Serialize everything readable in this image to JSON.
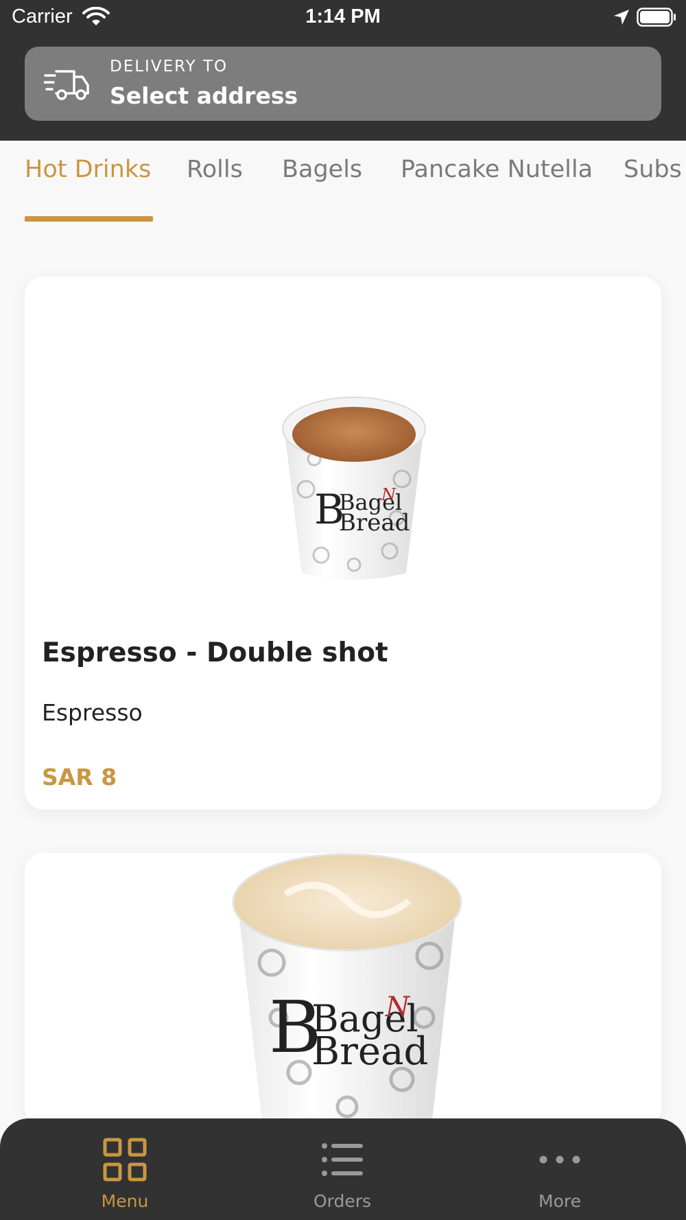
{
  "status_bar": {
    "carrier": "Carrier",
    "time": "1:14 PM"
  },
  "delivery": {
    "kicker": "DELIVERY TO",
    "address": "Select address"
  },
  "tabs": [
    {
      "label": "Hot Drinks",
      "active": true
    },
    {
      "label": "Rolls",
      "active": false
    },
    {
      "label": "Bagels",
      "active": false
    },
    {
      "label": "Pancake Nutella",
      "active": false
    },
    {
      "label": "Subs",
      "active": false
    }
  ],
  "products": [
    {
      "name": "Espresso - Double shot",
      "description": "Espresso",
      "price": "SAR 8",
      "image_icon": "espresso-cup-icon"
    },
    {
      "name": "",
      "description": "",
      "price": "",
      "image_icon": "latte-cup-icon"
    }
  ],
  "cup_brand": {
    "line1": "Bagel",
    "line1_mark": "N",
    "line2": "Bread"
  },
  "bottom_nav": [
    {
      "label": "Menu",
      "icon": "grid-icon",
      "active": true
    },
    {
      "label": "Orders",
      "icon": "list-icon",
      "active": false
    },
    {
      "label": "More",
      "icon": "more-icon",
      "active": false
    }
  ],
  "colors": {
    "accent": "#c99641",
    "header_bg": "#323232",
    "address_bg": "#7d7d7d",
    "page_bg": "#f8f8f8"
  }
}
